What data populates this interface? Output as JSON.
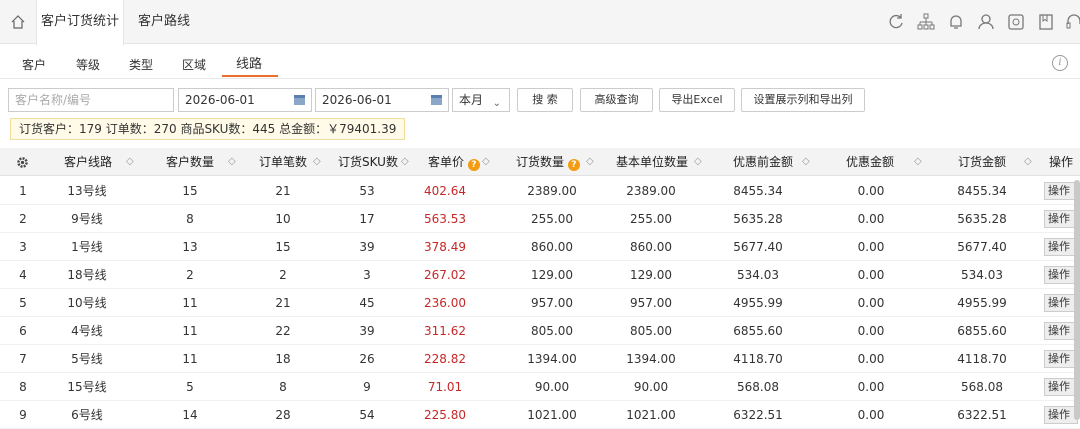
{
  "topbar": {
    "tabs": [
      {
        "label": "客户订货统计",
        "active": true
      },
      {
        "label": "客户路线",
        "active": false
      }
    ]
  },
  "subtabs": [
    {
      "label": "客户",
      "active": false
    },
    {
      "label": "等级",
      "active": false
    },
    {
      "label": "类型",
      "active": false
    },
    {
      "label": "区域",
      "active": false
    },
    {
      "label": "线路",
      "active": true
    }
  ],
  "filters": {
    "customer_placeholder": "客户名称/编号",
    "date_from": "2026-06-01",
    "date_to": "2026-06-01",
    "period": "本月",
    "search_label": "搜 索",
    "advanced_label": "高级查询",
    "export_label": "导出Excel",
    "settings_label": "设置展示列和导出列"
  },
  "summary": "订货客户：179 订单数：270 商品SKU数：445 总金额：￥79401.39",
  "table": {
    "headers": [
      "客户线路",
      "客户数量",
      "订单笔数",
      "订货SKU数",
      "客单价",
      "订货数量",
      "基本单位数量",
      "优惠前金额",
      "优惠金额",
      "订货金额",
      "操作"
    ],
    "op_label": "操作",
    "rows": [
      {
        "idx": "1",
        "route": "13号线",
        "customers": "15",
        "orders": "21",
        "sku": "53",
        "avg": "402.64",
        "qty": "2389.00",
        "base_qty": "2389.00",
        "pre_amt": "8455.34",
        "discount": "0.00",
        "amount": "8455.34"
      },
      {
        "idx": "2",
        "route": "9号线",
        "customers": "8",
        "orders": "10",
        "sku": "17",
        "avg": "563.53",
        "qty": "255.00",
        "base_qty": "255.00",
        "pre_amt": "5635.28",
        "discount": "0.00",
        "amount": "5635.28"
      },
      {
        "idx": "3",
        "route": "1号线",
        "customers": "13",
        "orders": "15",
        "sku": "39",
        "avg": "378.49",
        "qty": "860.00",
        "base_qty": "860.00",
        "pre_amt": "5677.40",
        "discount": "0.00",
        "amount": "5677.40"
      },
      {
        "idx": "4",
        "route": "18号线",
        "customers": "2",
        "orders": "2",
        "sku": "3",
        "avg": "267.02",
        "qty": "129.00",
        "base_qty": "129.00",
        "pre_amt": "534.03",
        "discount": "0.00",
        "amount": "534.03"
      },
      {
        "idx": "5",
        "route": "10号线",
        "customers": "11",
        "orders": "21",
        "sku": "45",
        "avg": "236.00",
        "qty": "957.00",
        "base_qty": "957.00",
        "pre_amt": "4955.99",
        "discount": "0.00",
        "amount": "4955.99"
      },
      {
        "idx": "6",
        "route": "4号线",
        "customers": "11",
        "orders": "22",
        "sku": "39",
        "avg": "311.62",
        "qty": "805.00",
        "base_qty": "805.00",
        "pre_amt": "6855.60",
        "discount": "0.00",
        "amount": "6855.60"
      },
      {
        "idx": "7",
        "route": "5号线",
        "customers": "11",
        "orders": "18",
        "sku": "26",
        "avg": "228.82",
        "qty": "1394.00",
        "base_qty": "1394.00",
        "pre_amt": "4118.70",
        "discount": "0.00",
        "amount": "4118.70"
      },
      {
        "idx": "8",
        "route": "15号线",
        "customers": "5",
        "orders": "8",
        "sku": "9",
        "avg": "71.01",
        "qty": "90.00",
        "base_qty": "90.00",
        "pre_amt": "568.08",
        "discount": "0.00",
        "amount": "568.08"
      },
      {
        "idx": "9",
        "route": "6号线",
        "customers": "14",
        "orders": "28",
        "sku": "54",
        "avg": "225.80",
        "qty": "1021.00",
        "base_qty": "1021.00",
        "pre_amt": "6322.51",
        "discount": "0.00",
        "amount": "6322.51"
      }
    ]
  },
  "colors": {
    "accent": "#e8702a",
    "price_red": "#c62828",
    "help_icon": "#f39c12"
  }
}
